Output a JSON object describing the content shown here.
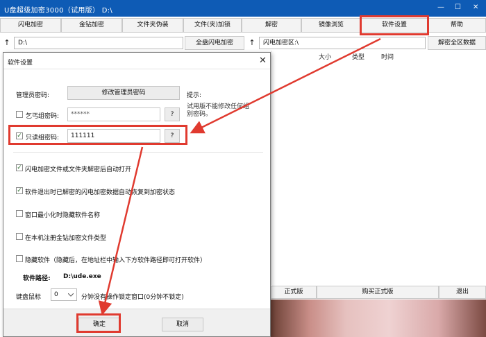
{
  "window": {
    "title": "U盘超级加密3000（试用版）  D:\\",
    "minimize_glyph": "—",
    "maximize_glyph": "☐",
    "close_glyph": "✕"
  },
  "toolbar": {
    "buttons": [
      "闪电加密",
      "金钻加密",
      "文件夹伪装",
      "文件(夹)加锁",
      "解密",
      "镜像浏览",
      "软件设置",
      "帮助"
    ]
  },
  "address": {
    "left_path": "D:\\",
    "flash_encrypt_all": "全盘闪电加密",
    "right_path": "闪电加密区:\\",
    "decrypt_all": "解密全区数据",
    "up_glyph": "↑"
  },
  "file_list": {
    "columns": [
      "大小",
      "类型",
      "时间"
    ]
  },
  "bottom_bar": {
    "buttons": [
      "正式版",
      "购买正式版",
      "退出"
    ]
  },
  "dialog": {
    "title": "软件设置",
    "close_glyph": "✕",
    "admin_password_label": "管理员密码:",
    "change_admin_password_button": "修改管理员密码",
    "hint_label": "提示:",
    "hint_text": "试用版不能修改任何组别密码。",
    "beggar_group_password_label": "乞丐组密码:",
    "beggar_group_password_value": "******",
    "help_button": "?",
    "readonly_group_password_label": "只读组密码:",
    "readonly_group_password_value": "111111",
    "check_glyph": "✓",
    "options": [
      {
        "label": "闪电加密文件或文件夹解密后自动打开",
        "checked": true
      },
      {
        "label": "软件退出时已解密的闪电加密数据自动恢复到加密状态",
        "checked": true
      },
      {
        "label": "窗口最小化时隐藏软件名称",
        "checked": false
      },
      {
        "label": "在本机注册金钻加密文件类型",
        "checked": false
      },
      {
        "label": "隐藏软件（隐藏后，在地址栏中输入下方软件路径即可打开软件）",
        "checked": false
      }
    ],
    "software_path_label": "软件路径:",
    "software_path_value": "D:\\ude.exe",
    "keyboard_mouse_label": "键盘鼠标",
    "idle_minutes_value": "0",
    "idle_lock_text": "分钟没有操作锁定窗口(0分钟不锁定)",
    "ok_button": "确定",
    "cancel_button": "取消"
  },
  "annotations": {
    "highlight_color": "#e03a2f"
  }
}
